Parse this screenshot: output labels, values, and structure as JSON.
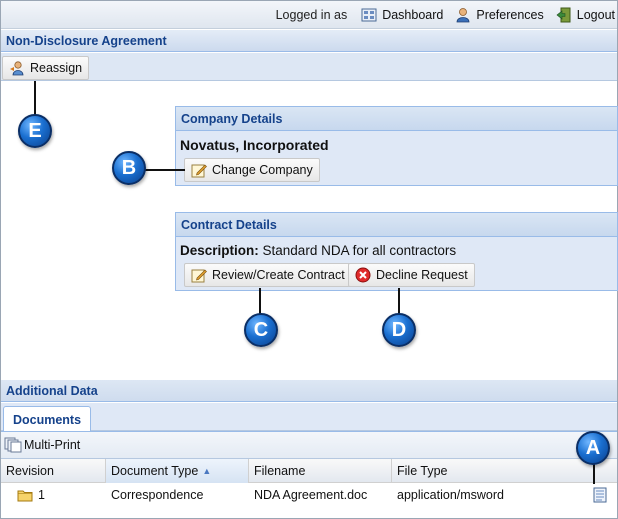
{
  "topbar": {
    "logged_in_text": "Logged in as",
    "dashboard_label": "Dashboard",
    "preferences_label": "Preferences",
    "logout_label": "Logout"
  },
  "page": {
    "title": "Non-Disclosure Agreement",
    "reassign_label": "Reassign"
  },
  "company": {
    "title": "Company Details",
    "name": "Novatus, Incorporated",
    "change_label": "Change Company"
  },
  "contract": {
    "title": "Contract Details",
    "description_label": "Description:",
    "description_value": "Standard NDA for all contractors",
    "review_label": "Review/Create Contract",
    "decline_label": "Decline Request"
  },
  "additional": {
    "title": "Additional Data",
    "tab_documents": "Documents",
    "multi_print_label": "Multi-Print"
  },
  "grid": {
    "columns": [
      "Revision",
      "Document Type",
      "Filename",
      "File Type"
    ],
    "sort_indicator": "▲",
    "rows": [
      {
        "revision": "1",
        "document_type": "Correspondence",
        "filename": "NDA Agreement.doc",
        "file_type": "application/msword"
      }
    ]
  },
  "callouts": {
    "a": "A",
    "b": "B",
    "c": "C",
    "d": "D",
    "e": "E"
  }
}
